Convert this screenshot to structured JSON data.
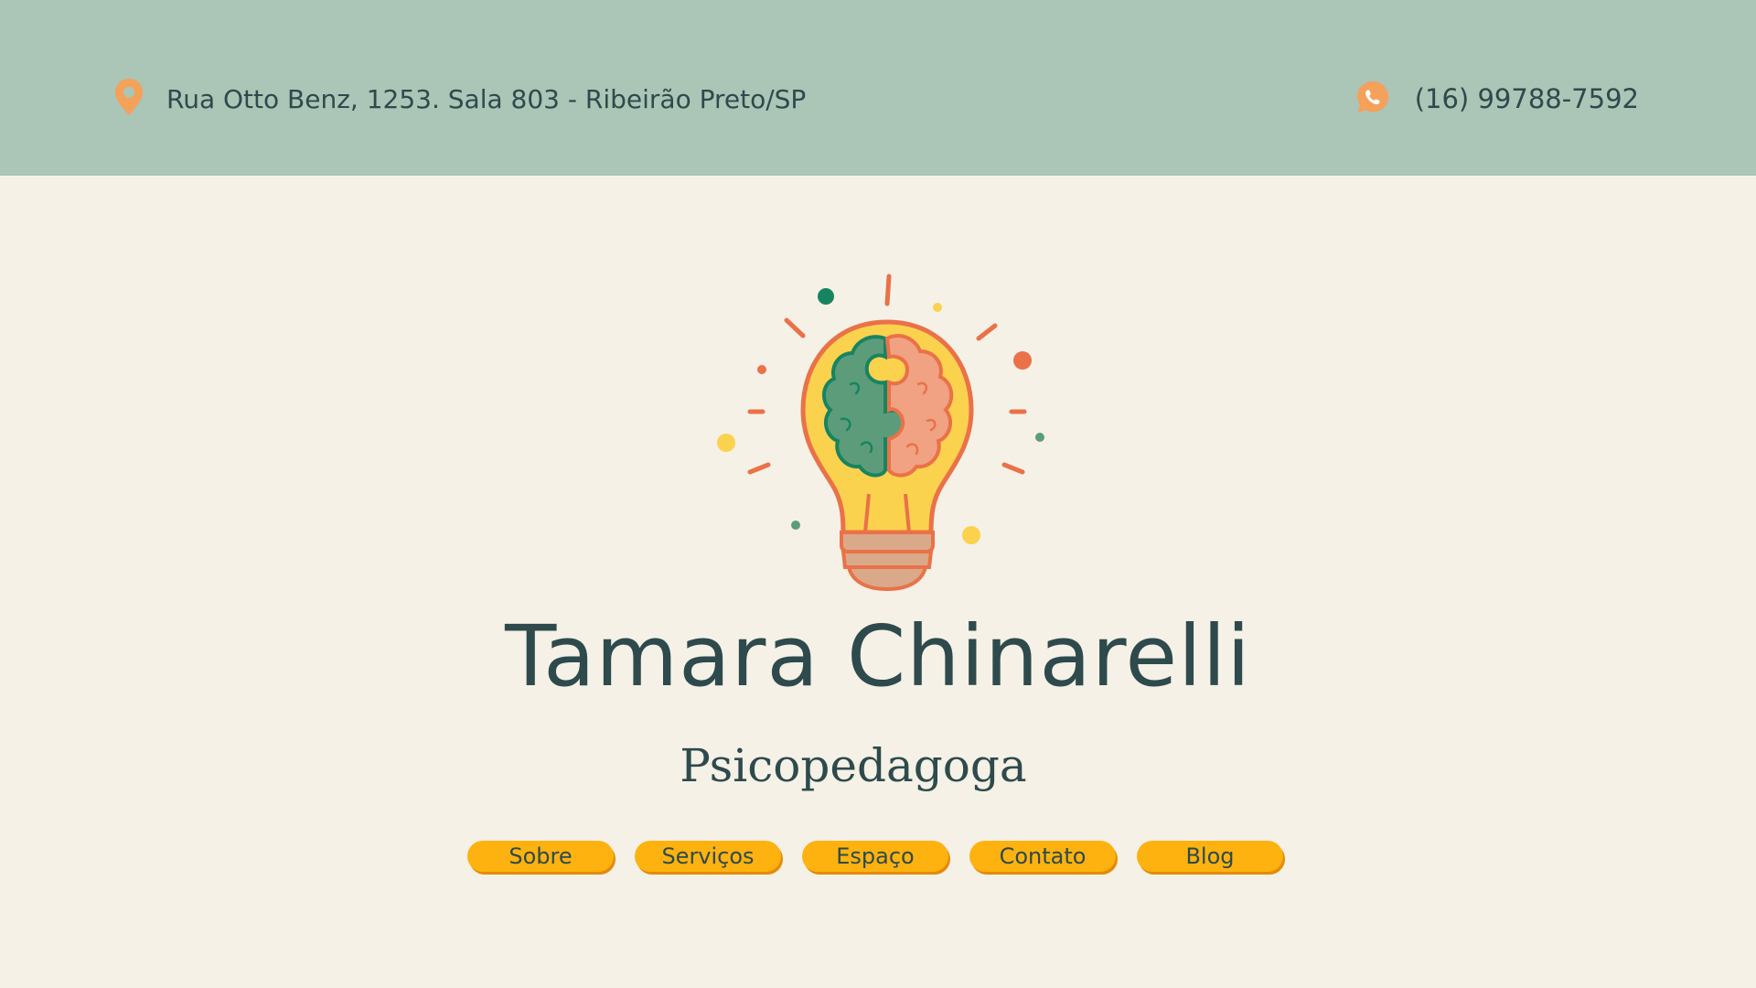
{
  "topbar": {
    "address": "Rua Otto Benz, 1253. Sala 803 - Ribeirão Preto/SP",
    "address_icon": "location-pin-icon",
    "phone": "(16) 99788-7592",
    "phone_icon": "whatsapp-icon"
  },
  "hero": {
    "name": "Tamara Chinarelli",
    "role": "Psicopedagoga",
    "logo_icon": "lightbulb-brain-icon"
  },
  "nav": {
    "items": [
      {
        "label": "Sobre"
      },
      {
        "label": "Serviços"
      },
      {
        "label": "Espaço"
      },
      {
        "label": "Contato"
      },
      {
        "label": "Blog"
      }
    ]
  },
  "colors": {
    "topbar_bg": "#abc5b7",
    "page_bg": "#f5f1e6",
    "text": "#2e4a4c",
    "button": "#fdb210",
    "accent_orange": "#f4a15a",
    "brain_green": "#5d9c7a",
    "brain_pink": "#f0a283",
    "bulb_yellow": "#fbd24e"
  }
}
